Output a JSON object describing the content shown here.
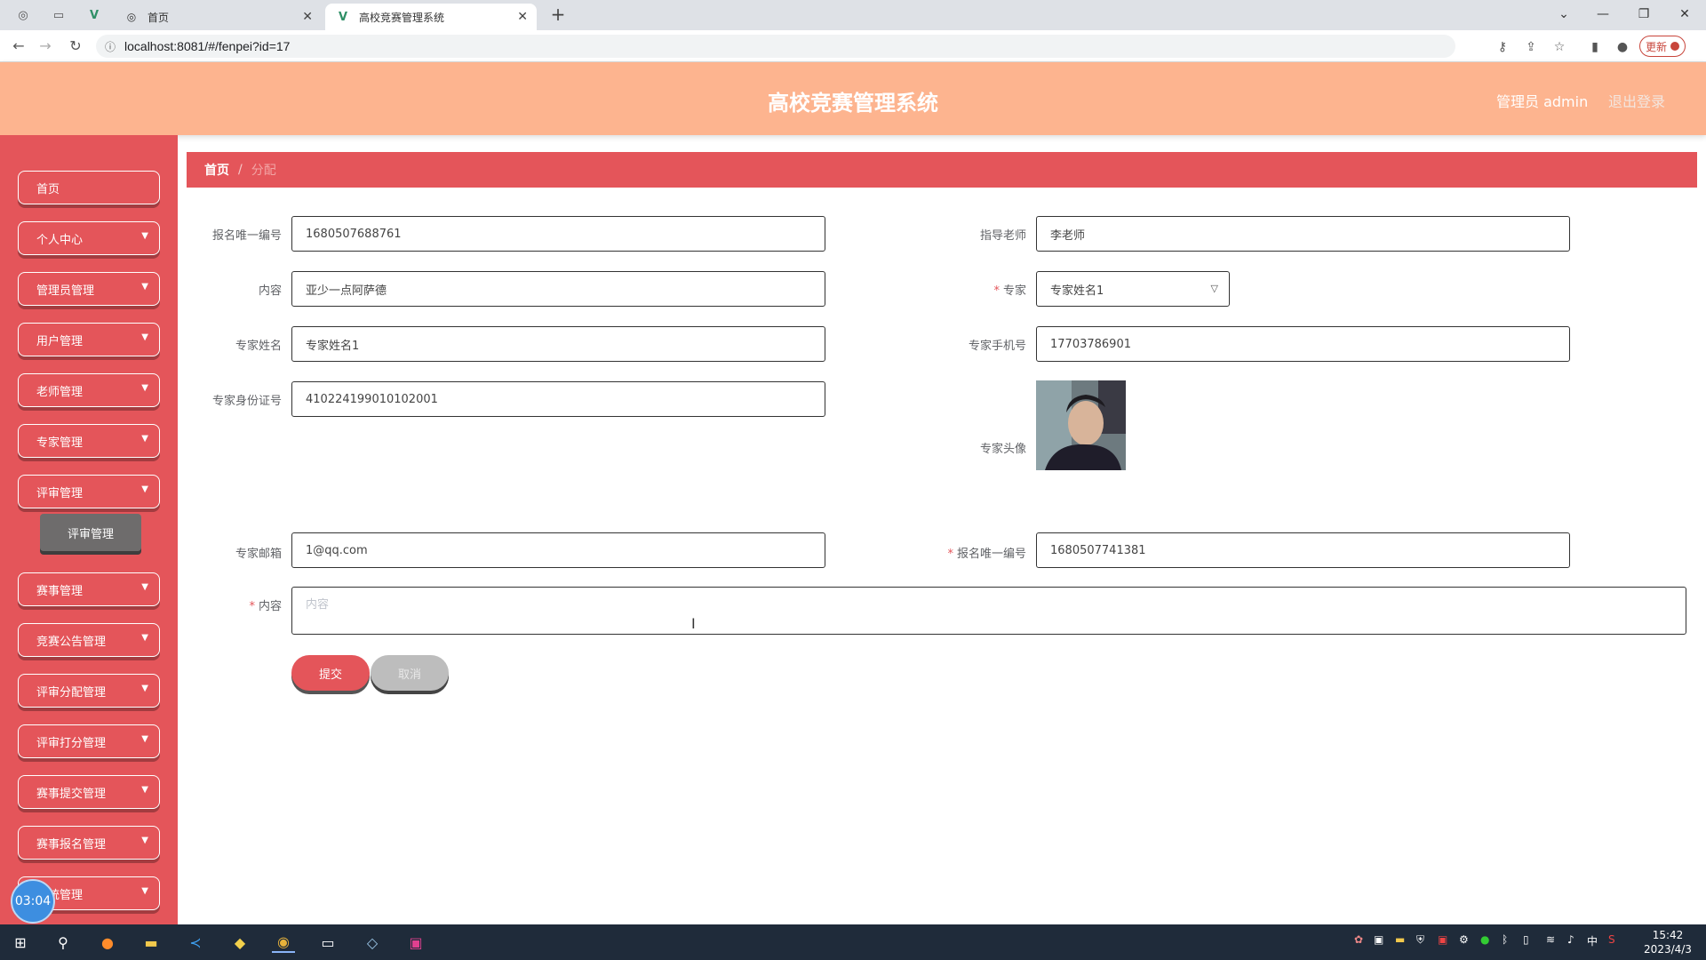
{
  "browser": {
    "tabs": [
      {
        "title": "首页",
        "active": false
      },
      {
        "title": "高校竞赛管理系统",
        "active": true
      }
    ],
    "url": "localhost:8081/#/fenpei?id=17",
    "update_label": "更新"
  },
  "header": {
    "title": "高校竞赛管理系统",
    "user_label": "管理员 admin",
    "logout_label": "退出登录"
  },
  "sidebar": {
    "items": [
      {
        "label": "首页",
        "has_children": false
      },
      {
        "label": "个人中心",
        "has_children": true
      },
      {
        "label": "管理员管理",
        "has_children": true
      },
      {
        "label": "用户管理",
        "has_children": true
      },
      {
        "label": "老师管理",
        "has_children": true
      },
      {
        "label": "专家管理",
        "has_children": true
      },
      {
        "label": "评审管理",
        "has_children": true
      },
      {
        "label": "赛事管理",
        "has_children": true
      },
      {
        "label": "竞赛公告管理",
        "has_children": true
      },
      {
        "label": "评审分配管理",
        "has_children": true
      },
      {
        "label": "评审打分管理",
        "has_children": true
      },
      {
        "label": "赛事提交管理",
        "has_children": true
      },
      {
        "label": "赛事报名管理",
        "has_children": true
      },
      {
        "label": "系统管理",
        "has_children": true
      }
    ],
    "submenu_label": "评审管理",
    "timer": "03:04"
  },
  "breadcrumb": {
    "home": "首页",
    "separator": "/",
    "current": "分配"
  },
  "form": {
    "baoming_no": {
      "label": "报名唯一编号",
      "value": "1680507688761"
    },
    "teacher": {
      "label": "指导老师",
      "value": "李老师"
    },
    "content_top": {
      "label": "内容",
      "value": "亚少一点阿萨德"
    },
    "expert": {
      "label": "专家",
      "value": "专家姓名1"
    },
    "expert_name": {
      "label": "专家姓名",
      "value": "专家姓名1"
    },
    "expert_phone": {
      "label": "专家手机号",
      "value": "17703786901"
    },
    "expert_id": {
      "label": "专家身份证号",
      "value": "410224199010102001"
    },
    "expert_avatar": {
      "label": "专家头像"
    },
    "expert_email": {
      "label": "专家邮箱",
      "value": "1@qq.com"
    },
    "baoming_no2": {
      "label": "报名唯一编号",
      "value": "1680507741381"
    },
    "content": {
      "label": "内容",
      "placeholder": "内容"
    },
    "required_mark": "*",
    "submit_label": "提交",
    "cancel_label": "取消"
  },
  "taskbar": {
    "time": "15:42",
    "date": "2023/4/3",
    "ime": "中"
  },
  "colors": {
    "header": "#fdb48f",
    "primary": "#e4555a",
    "submenu": "#6e6c6c"
  }
}
